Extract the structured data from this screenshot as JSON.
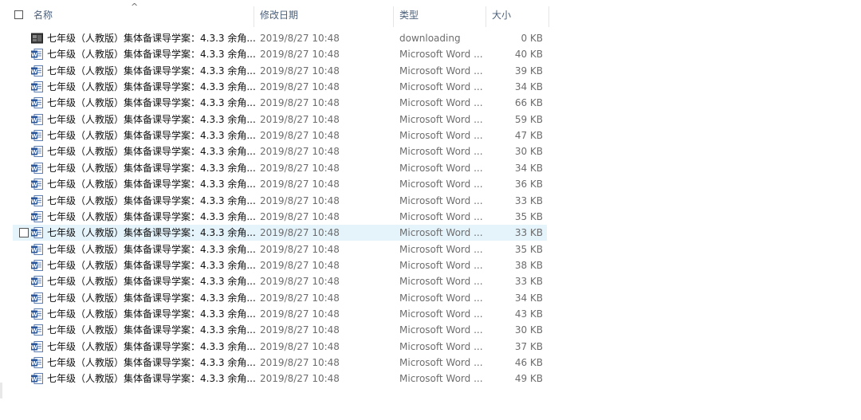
{
  "header": {
    "name": "名称",
    "date_modified": "修改日期",
    "type": "类型",
    "size": "大小",
    "sort_indicator": "^"
  },
  "colors": {
    "hover_row": "#e5f3fb",
    "word_icon": "#2b579a"
  },
  "files": [
    {
      "name": "七年级（人教版）集体备课导学案：4.3.3 余角...",
      "date": "2019/8/27 10:48",
      "type": "downloading",
      "size": "0 KB",
      "icon": "downloading-file-icon"
    },
    {
      "name": "七年级（人教版）集体备课导学案：4.3.3 余角...",
      "date": "2019/8/27 10:48",
      "type": "Microsoft Word ...",
      "size": "40 KB",
      "icon": "word-document-icon"
    },
    {
      "name": "七年级（人教版）集体备课导学案：4.3.3 余角...",
      "date": "2019/8/27 10:48",
      "type": "Microsoft Word ...",
      "size": "39 KB",
      "icon": "word-document-icon"
    },
    {
      "name": "七年级（人教版）集体备课导学案：4.3.3 余角...",
      "date": "2019/8/27 10:48",
      "type": "Microsoft Word ...",
      "size": "34 KB",
      "icon": "word-document-icon"
    },
    {
      "name": "七年级（人教版）集体备课导学案：4.3.3 余角...",
      "date": "2019/8/27 10:48",
      "type": "Microsoft Word ...",
      "size": "66 KB",
      "icon": "word-document-icon"
    },
    {
      "name": "七年级（人教版）集体备课导学案：4.3.3 余角...",
      "date": "2019/8/27 10:48",
      "type": "Microsoft Word ...",
      "size": "59 KB",
      "icon": "word-document-icon"
    },
    {
      "name": "七年级（人教版）集体备课导学案：4.3.3 余角...",
      "date": "2019/8/27 10:48",
      "type": "Microsoft Word ...",
      "size": "47 KB",
      "icon": "word-document-icon"
    },
    {
      "name": "七年级（人教版）集体备课导学案：4.3.3 余角...",
      "date": "2019/8/27 10:48",
      "type": "Microsoft Word ...",
      "size": "30 KB",
      "icon": "word-document-icon"
    },
    {
      "name": "七年级（人教版）集体备课导学案：4.3.3 余角...",
      "date": "2019/8/27 10:48",
      "type": "Microsoft Word ...",
      "size": "34 KB",
      "icon": "word-document-icon"
    },
    {
      "name": "七年级（人教版）集体备课导学案：4.3.3 余角...",
      "date": "2019/8/27 10:48",
      "type": "Microsoft Word ...",
      "size": "36 KB",
      "icon": "word-document-icon"
    },
    {
      "name": "七年级（人教版）集体备课导学案：4.3.3 余角...",
      "date": "2019/8/27 10:48",
      "type": "Microsoft Word ...",
      "size": "33 KB",
      "icon": "word-document-icon"
    },
    {
      "name": "七年级（人教版）集体备课导学案：4.3.3 余角...",
      "date": "2019/8/27 10:48",
      "type": "Microsoft Word ...",
      "size": "35 KB",
      "icon": "word-document-icon"
    },
    {
      "name": "七年级（人教版）集体备课导学案：4.3.3 余角...",
      "date": "2019/8/27 10:48",
      "type": "Microsoft Word ...",
      "size": "33 KB",
      "icon": "word-document-icon",
      "hover": true
    },
    {
      "name": "七年级（人教版）集体备课导学案：4.3.3 余角...",
      "date": "2019/8/27 10:48",
      "type": "Microsoft Word ...",
      "size": "35 KB",
      "icon": "word-document-icon"
    },
    {
      "name": "七年级（人教版）集体备课导学案：4.3.3 余角...",
      "date": "2019/8/27 10:48",
      "type": "Microsoft Word ...",
      "size": "38 KB",
      "icon": "word-document-icon"
    },
    {
      "name": "七年级（人教版）集体备课导学案：4.3.3 余角...",
      "date": "2019/8/27 10:48",
      "type": "Microsoft Word ...",
      "size": "33 KB",
      "icon": "word-document-icon"
    },
    {
      "name": "七年级（人教版）集体备课导学案：4.3.3 余角...",
      "date": "2019/8/27 10:48",
      "type": "Microsoft Word ...",
      "size": "34 KB",
      "icon": "word-document-icon"
    },
    {
      "name": "七年级（人教版）集体备课导学案：4.3.3 余角...",
      "date": "2019/8/27 10:48",
      "type": "Microsoft Word ...",
      "size": "43 KB",
      "icon": "word-document-icon"
    },
    {
      "name": "七年级（人教版）集体备课导学案：4.3.3 余角...",
      "date": "2019/8/27 10:48",
      "type": "Microsoft Word ...",
      "size": "30 KB",
      "icon": "word-document-icon"
    },
    {
      "name": "七年级（人教版）集体备课导学案：4.3.3 余角...",
      "date": "2019/8/27 10:48",
      "type": "Microsoft Word ...",
      "size": "37 KB",
      "icon": "word-document-icon"
    },
    {
      "name": "七年级（人教版）集体备课导学案：4.3.3 余角...",
      "date": "2019/8/27 10:48",
      "type": "Microsoft Word ...",
      "size": "46 KB",
      "icon": "word-document-icon"
    },
    {
      "name": "七年级（人教版）集体备课导学案：4.3.3 余角...",
      "date": "2019/8/27 10:48",
      "type": "Microsoft Word ...",
      "size": "49 KB",
      "icon": "word-document-icon"
    }
  ]
}
